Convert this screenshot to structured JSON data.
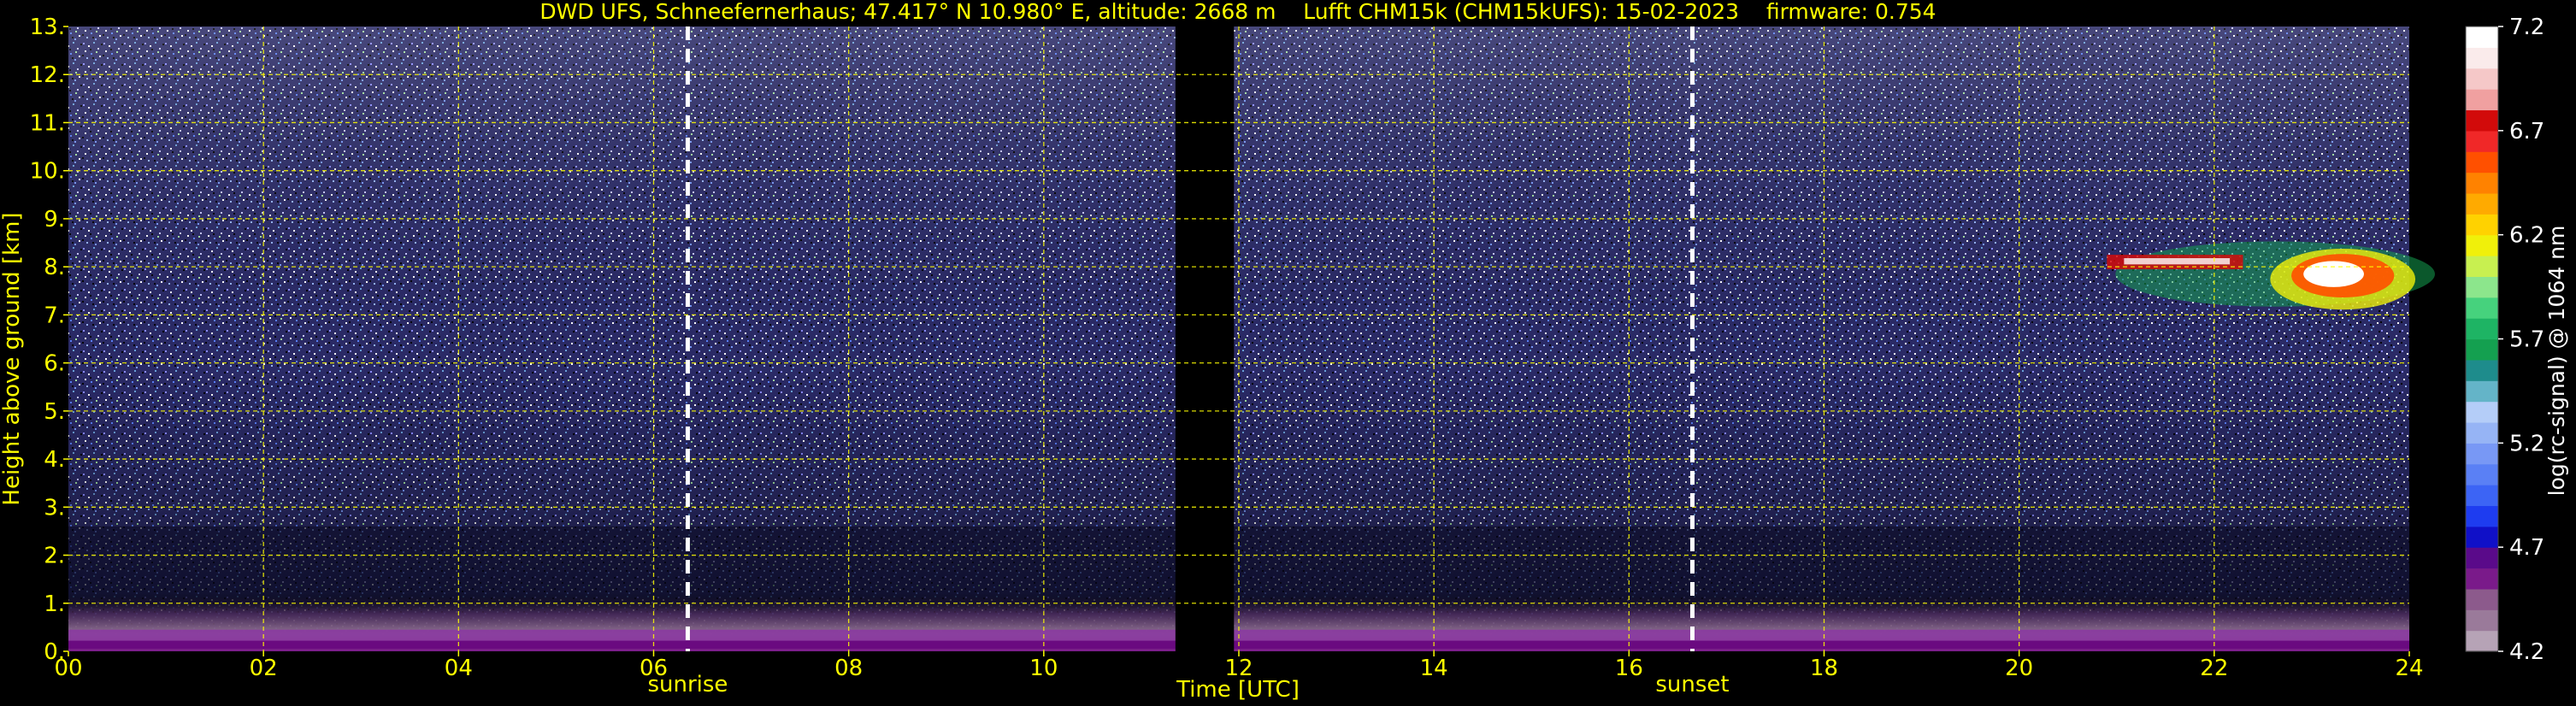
{
  "chart_data": {
    "type": "heatmap",
    "title": "DWD UFS, Schneefernerhaus; 47.417° N 10.980° E, altitude: 2668 m    Lufft CHM15k (CHM15kUFS): 15-02-2023    firmware: 0.754",
    "xlabel": "Time [UTC]",
    "ylabel": "Height above ground [km]",
    "xlim": [
      0,
      24
    ],
    "ylim": [
      0,
      13
    ],
    "x_ticks": [
      {
        "value": 0,
        "label": "00"
      },
      {
        "value": 2,
        "label": "02"
      },
      {
        "value": 4,
        "label": "04"
      },
      {
        "value": 6,
        "label": "06"
      },
      {
        "value": 8,
        "label": "08"
      },
      {
        "value": 10,
        "label": "10"
      },
      {
        "value": 12,
        "label": "12"
      },
      {
        "value": 14,
        "label": "14"
      },
      {
        "value": 16,
        "label": "16"
      },
      {
        "value": 18,
        "label": "18"
      },
      {
        "value": 20,
        "label": "20"
      },
      {
        "value": 22,
        "label": "22"
      },
      {
        "value": 24,
        "label": "24"
      }
    ],
    "y_ticks": [
      {
        "value": 0,
        "label": "0."
      },
      {
        "value": 1,
        "label": "1."
      },
      {
        "value": 2,
        "label": "2."
      },
      {
        "value": 3,
        "label": "3."
      },
      {
        "value": 4,
        "label": "4."
      },
      {
        "value": 5,
        "label": "5."
      },
      {
        "value": 6,
        "label": "6."
      },
      {
        "value": 7,
        "label": "7."
      },
      {
        "value": 8,
        "label": "8."
      },
      {
        "value": 9,
        "label": "9."
      },
      {
        "value": 10,
        "label": "10."
      },
      {
        "value": 11,
        "label": "11."
      },
      {
        "value": 12,
        "label": "12."
      },
      {
        "value": 13,
        "label": "13."
      }
    ],
    "grid": true,
    "data_gap_utc": [
      11.35,
      11.95
    ],
    "events": [
      {
        "label": "sunrise",
        "time": 6.35
      },
      {
        "label": "sunset",
        "time": 16.65
      }
    ],
    "cloud_layers": [
      {
        "t_start": 20.9,
        "t_end": 24.0,
        "base_km": 6.9,
        "top_km": 8.8
      }
    ],
    "colorbar": {
      "label": "log(rc-signal) @ 1064 nm",
      "range": [
        4.2,
        7.2
      ],
      "ticks": [
        {
          "value": 4.2,
          "label": "4.2"
        },
        {
          "value": 4.7,
          "label": "4.7"
        },
        {
          "value": 5.2,
          "label": "5.2"
        },
        {
          "value": 5.7,
          "label": "5.7"
        },
        {
          "value": 6.2,
          "label": "6.2"
        },
        {
          "value": 6.7,
          "label": "6.7"
        },
        {
          "value": 7.2,
          "label": "7.2"
        }
      ],
      "colors": [
        "#b6a3b6",
        "#9a7a9a",
        "#8c5a8c",
        "#7a1a8a",
        "#5a0a8a",
        "#1010c8",
        "#1e3cf0",
        "#3c64f5",
        "#5a80f5",
        "#7898f5",
        "#96b4f5",
        "#b4cdf8",
        "#64b4c8",
        "#1e8c8c",
        "#14a050",
        "#1eb464",
        "#46d27d",
        "#8ce68c",
        "#c8f050",
        "#f0f00a",
        "#ffd200",
        "#ffaa00",
        "#ff8200",
        "#ff5000",
        "#f02828",
        "#d20a0a",
        "#f0a0a0",
        "#f5c8c8",
        "#faebeb",
        "#ffffff"
      ]
    },
    "colors": {
      "text": "#ffff00",
      "grid": "#ffff00",
      "background": "#000000",
      "event_line": "#ffffff",
      "colorbar_text": "#ffffff"
    }
  }
}
